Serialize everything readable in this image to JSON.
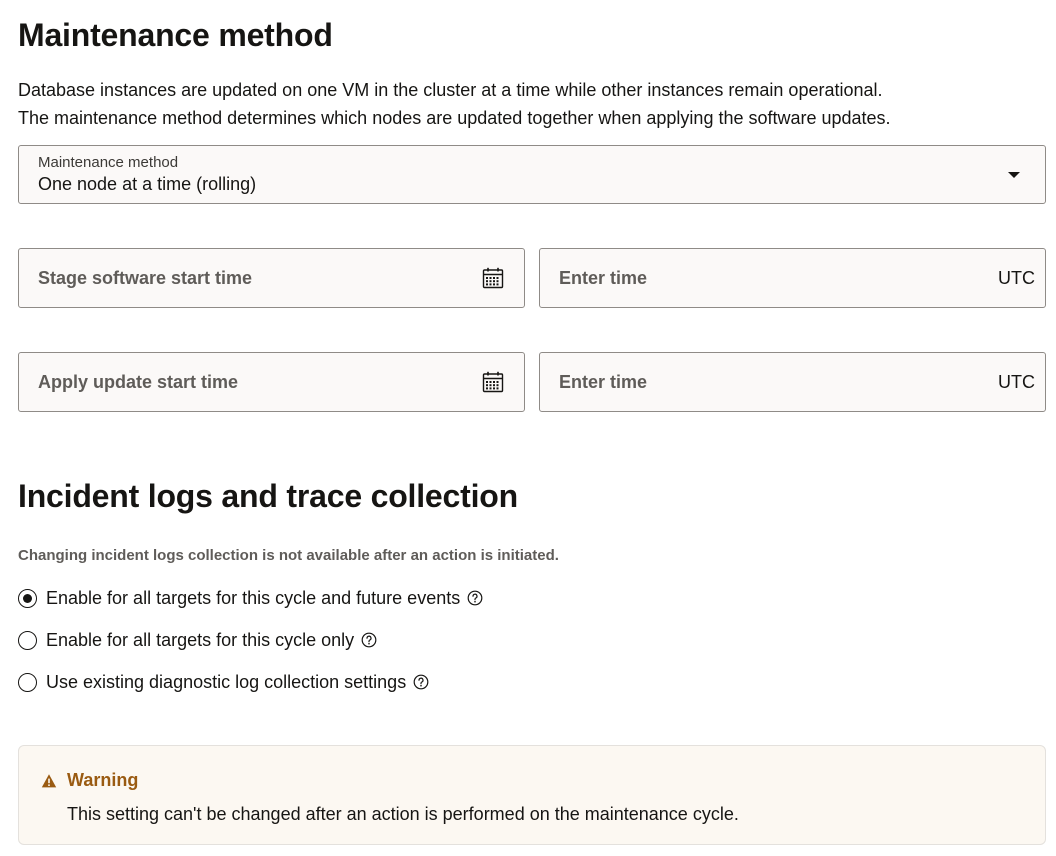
{
  "maintenance": {
    "title": "Maintenance method",
    "description_line1": "Database instances are updated on one VM in the cluster at a time while other instances remain operational.",
    "description_line2": "The maintenance method determines which nodes are updated together when applying the software updates.",
    "select_label": "Maintenance method",
    "select_value": "One node at a time (rolling)",
    "stage_placeholder": "Stage software start time",
    "stage_time_placeholder": "Enter time",
    "apply_placeholder": "Apply update start time",
    "apply_time_placeholder": "Enter time",
    "timezone": "UTC"
  },
  "incident": {
    "title": "Incident logs and trace collection",
    "note": "Changing incident logs collection is not available after an action is initiated.",
    "options": [
      {
        "label": "Enable for all targets for this cycle and future events",
        "selected": true
      },
      {
        "label": "Enable for all targets for this cycle only",
        "selected": false
      },
      {
        "label": "Use existing diagnostic log collection settings",
        "selected": false
      }
    ]
  },
  "warning": {
    "title": "Warning",
    "message": "This setting can't be changed after an action is performed on the maintenance cycle."
  },
  "icons": {
    "calendar": "calendar-icon",
    "help": "help-circle-icon",
    "warning": "warning-triangle-icon",
    "dropdown": "caret-down-icon"
  },
  "colors": {
    "field_bg": "#fbf9f8",
    "field_border": "#8f8b87",
    "warning_bg": "#fcf8f2",
    "warning_title": "#9a5b12"
  }
}
